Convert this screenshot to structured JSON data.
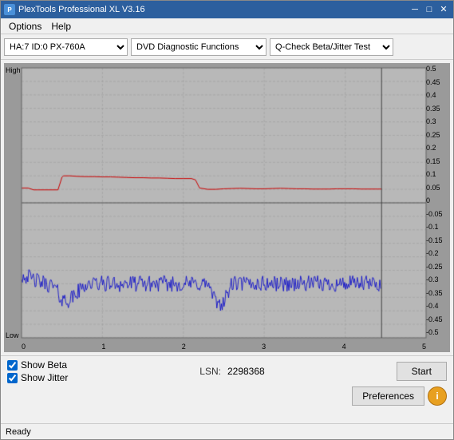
{
  "window": {
    "title": "PlexTools Professional XL V3.16",
    "icon": "P"
  },
  "menu": {
    "options": "Options",
    "help": "Help"
  },
  "toolbar": {
    "drive": "HA:7 ID:0  PX-760A",
    "function": "DVD Diagnostic Functions",
    "test": "Q-Check Beta/Jitter Test"
  },
  "chart": {
    "y_labels": [
      "0.5",
      "0.45",
      "0.4",
      "0.35",
      "0.3",
      "0.25",
      "0.2",
      "0.15",
      "0.1",
      "0.05",
      "0",
      "-0.05",
      "-0.1",
      "-0.15",
      "-0.2",
      "-0.25",
      "-0.3",
      "-0.35",
      "-0.4",
      "-0.45",
      "-0.5"
    ],
    "x_labels": [
      "0",
      "1",
      "2",
      "3",
      "4",
      "5"
    ],
    "high_label": "High",
    "low_label": "Low"
  },
  "bottom": {
    "show_beta_label": "Show Beta",
    "show_jitter_label": "Show Jitter",
    "lsn_label": "LSN:",
    "lsn_value": "2298368",
    "start_label": "Start",
    "preferences_label": "Preferences",
    "info_label": "i"
  },
  "status": {
    "text": "Ready"
  }
}
